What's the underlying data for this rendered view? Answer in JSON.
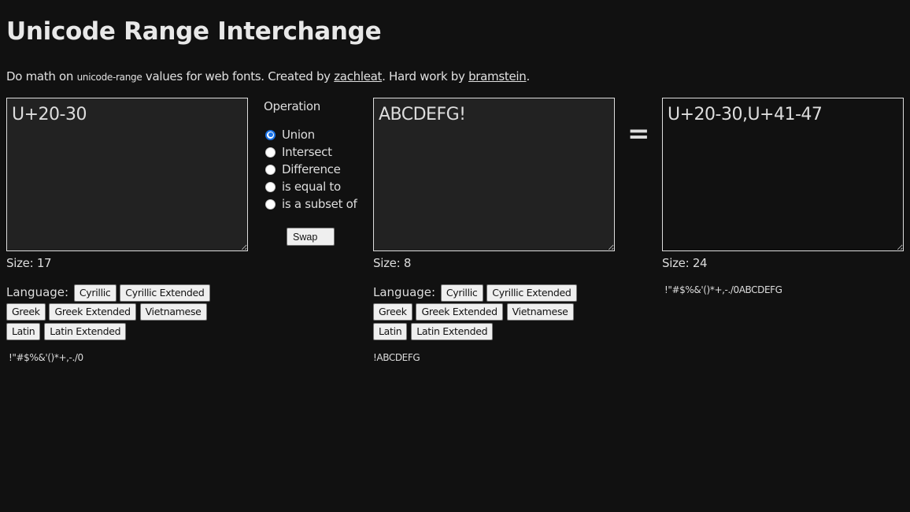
{
  "header": {
    "title": "Unicode Range Interchange",
    "intro_prefix": "Do math on ",
    "intro_code": "unicode-range",
    "intro_middle": " values for web fonts. Created by ",
    "link_author": "zachleat",
    "intro_middle2": ". Hard work by ",
    "link_helper": "bramstein",
    "intro_suffix": "."
  },
  "left": {
    "value": "U+20-30",
    "size_label": "Size: 17",
    "language_label": "Language:",
    "buttons": [
      "Cyrillic",
      "Cyrillic Extended",
      "Greek",
      "Greek Extended",
      "Vietnamese",
      "Latin",
      "Latin Extended"
    ],
    "chars": "!\"#$%&'()*+,-./0"
  },
  "operation": {
    "title": "Operation",
    "options": [
      "Union",
      "Intersect",
      "Difference",
      "is equal to",
      "is a subset of"
    ],
    "selected": "Union",
    "swap_label": "Swap"
  },
  "right": {
    "value": "ABCDEFG!",
    "size_label": "Size: 8",
    "language_label": "Language:",
    "buttons": [
      "Cyrillic",
      "Cyrillic Extended",
      "Greek",
      "Greek Extended",
      "Vietnamese",
      "Latin",
      "Latin Extended"
    ],
    "chars": "!ABCDEFG"
  },
  "equals": "=",
  "result": {
    "value": "U+20-30,U+41-47",
    "size_label": "Size: 24",
    "chars": "!\"#$%&'()*+,-./0ABCDEFG"
  }
}
